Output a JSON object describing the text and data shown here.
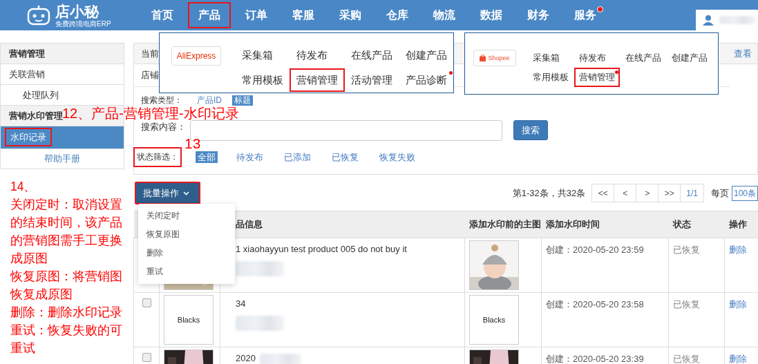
{
  "logo": {
    "name": "店小秘",
    "tagline": "免费跨境电商ERP"
  },
  "nav": [
    {
      "label": "首页",
      "highlighted": false,
      "badge": false
    },
    {
      "label": "产品",
      "highlighted": true,
      "badge": false
    },
    {
      "label": "订单",
      "highlighted": false,
      "badge": false
    },
    {
      "label": "客服",
      "highlighted": false,
      "badge": false
    },
    {
      "label": "采购",
      "highlighted": false,
      "badge": false
    },
    {
      "label": "仓库",
      "highlighted": false,
      "badge": false
    },
    {
      "label": "物流",
      "highlighted": false,
      "badge": false
    },
    {
      "label": "数据",
      "highlighted": false,
      "badge": false
    },
    {
      "label": "财务",
      "highlighted": false,
      "badge": false
    },
    {
      "label": "服务",
      "highlighted": false,
      "badge": true
    }
  ],
  "product_menu": [
    {
      "brand": "AliExpress",
      "kind": "aliexpress",
      "items": [
        {
          "label": "采集箱",
          "highlighted": false,
          "badge": false
        },
        {
          "label": "待发布",
          "highlighted": false,
          "badge": false
        },
        {
          "label": "在线产品",
          "highlighted": false,
          "badge": false
        },
        {
          "label": "创建产品",
          "highlighted": false,
          "badge": false
        },
        {
          "label": "常用模板",
          "highlighted": false,
          "badge": false
        },
        {
          "label": "营销管理",
          "highlighted": true,
          "badge": false
        },
        {
          "label": "活动管理",
          "highlighted": false,
          "badge": false
        },
        {
          "label": "产品诊断",
          "highlighted": false,
          "badge": true
        }
      ]
    },
    {
      "brand": "Shopee",
      "kind": "shopee",
      "items": [
        {
          "label": "采集箱",
          "highlighted": false,
          "badge": false
        },
        {
          "label": "待发布",
          "highlighted": false,
          "badge": false
        },
        {
          "label": "在线产品",
          "highlighted": false,
          "badge": false
        },
        {
          "label": "创建产品",
          "highlighted": false,
          "badge": false
        },
        {
          "label": "常用模板",
          "highlighted": false,
          "badge": false
        },
        {
          "label": "营销管理",
          "highlighted": true,
          "badge": true
        }
      ]
    }
  ],
  "sidebar": {
    "items": [
      {
        "label": "营销管理",
        "kind": "header",
        "highlighted": false
      },
      {
        "label": "关联营销",
        "kind": "item",
        "selected": false,
        "highlighted": false
      },
      {
        "label": "处理队列",
        "kind": "subitem",
        "selected": false,
        "highlighted": false
      },
      {
        "label": "营销水印管理",
        "kind": "header",
        "highlighted": false
      },
      {
        "label": "水印记录",
        "kind": "item",
        "selected": true,
        "highlighted": true
      }
    ],
    "help": "帮助手册"
  },
  "breadcrumb": {
    "text": "当前",
    "link": "查看"
  },
  "shop_label": "店铺",
  "search_type": {
    "label": "搜索类型：",
    "options": [
      {
        "label": "产品ID",
        "selected": false
      },
      {
        "label": "标题",
        "selected": true
      }
    ]
  },
  "search_content": {
    "label": "搜索内容：",
    "button": "搜索"
  },
  "status_filter": {
    "label": "状态筛选：",
    "highlighted": true,
    "options": [
      {
        "label": "全部",
        "selected": true
      },
      {
        "label": "待发布",
        "selected": false
      },
      {
        "label": "已添加",
        "selected": false
      },
      {
        "label": "已恢复",
        "selected": false
      },
      {
        "label": "恢复失败",
        "selected": false
      }
    ]
  },
  "batch": {
    "label": "批量操作",
    "highlighted": true,
    "menu": [
      "关闭定时",
      "恢复原图",
      "删除",
      "重试"
    ]
  },
  "pagination": {
    "summary": "第1-32条，共32条",
    "buttons": [
      "<<",
      "<",
      ">",
      ">>"
    ],
    "page": "1/1",
    "per_page_label": "每页",
    "per_page": "100条"
  },
  "table": {
    "columns": [
      "品信息",
      "添加水印前的主图",
      "添加水印时间",
      "状态",
      "操作"
    ],
    "rows": [
      {
        "title": "1 xiaohayyun test product 005 do not buy it",
        "redaction": {
          "kind": "below"
        },
        "time": "创建：2020-05-20 23:59",
        "status": "已恢复",
        "action": "删除"
      },
      {
        "checked": false,
        "image": {
          "kind": "text",
          "text": "Blacks"
        },
        "title": "34",
        "redaction": {
          "kind": "below"
        },
        "main_image": {
          "kind": "text",
          "text": "Blacks"
        },
        "time": "创建：2020-05-20 23:58",
        "status": "已恢复",
        "action": "删除"
      },
      {
        "checked": false,
        "title": "2020",
        "redaction": {
          "kind": "inline"
        },
        "time": "创建：2020-05-20 23:39",
        "status": "已恢复",
        "action": "删除"
      }
    ]
  },
  "annotations": [
    {
      "kind": "title",
      "text": "12、产品-营销管理-水印记录"
    },
    {
      "kind": "number",
      "text": "13"
    },
    {
      "kind": "note",
      "lines": [
        "14、",
        "关闭定时：取消设置的结束时间，该产品的营销图需手工更换成原图",
        "恢复原图：将营销图恢复成原图",
        "删除：删除水印记录",
        "重试：恢复失败的可重试"
      ]
    }
  ]
}
